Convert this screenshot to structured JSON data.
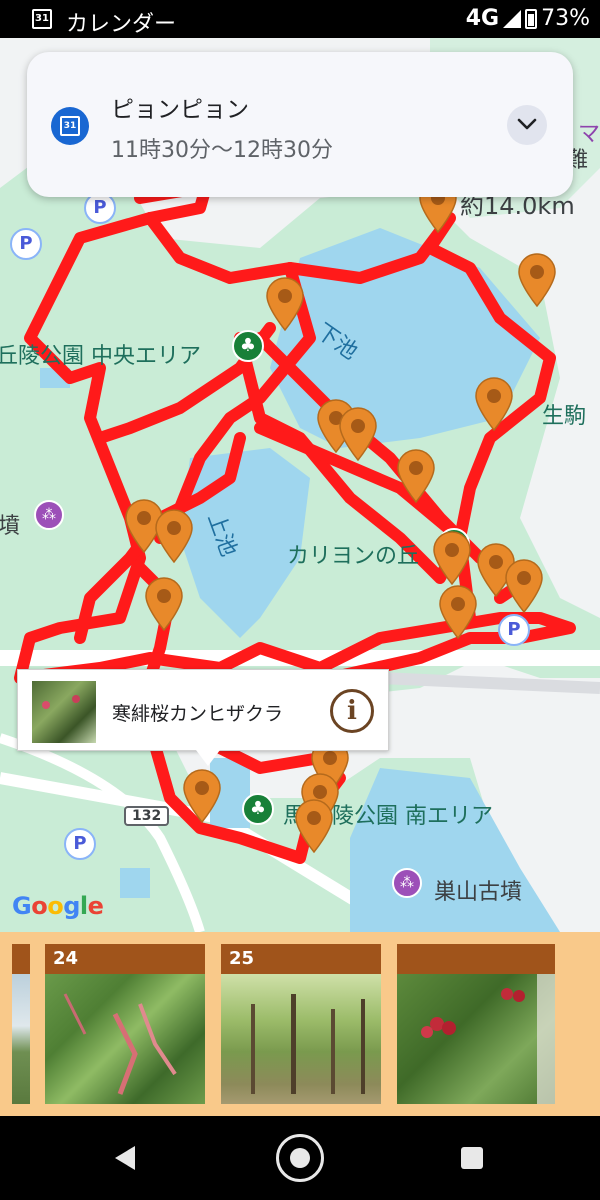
{
  "status_bar": {
    "app_name": "カレンダー",
    "calendar_day": "31",
    "network": "4G",
    "battery": "73%"
  },
  "notification": {
    "title": "ピョンピョン",
    "time": "11時30分～12時30分",
    "calendar_day": "31"
  },
  "map": {
    "labels": {
      "shimoike": "下池",
      "kamiike": "上池",
      "central_area": "丘陵公園 中央エリア",
      "carillon": "カリヨンの丘",
      "ikoma": "生駒",
      "south_area": "丘陵公園 南エリア",
      "south_area_prefix": "馬見",
      "suyama": "巣山古墳",
      "kofun_partial": "墳",
      "distance": "約14.0km",
      "ma": "マ",
      "nan": "難"
    },
    "route_number": "132",
    "google_logo": [
      "G",
      "o",
      "o",
      "g",
      "l",
      "e"
    ]
  },
  "popup": {
    "text": "寒緋桜カンヒザクラ",
    "info_glyph": "i"
  },
  "photo_strip": {
    "items": [
      {
        "number": "24"
      },
      {
        "number": "25"
      },
      {
        "number": ""
      }
    ]
  },
  "colors": {
    "route": "#ff1a1a",
    "pin": "#e8892a",
    "water": "#9fd6ee",
    "park": "#c9ecd6",
    "strip_bg": "#f9c98a",
    "photo_header": "#a0541b"
  }
}
